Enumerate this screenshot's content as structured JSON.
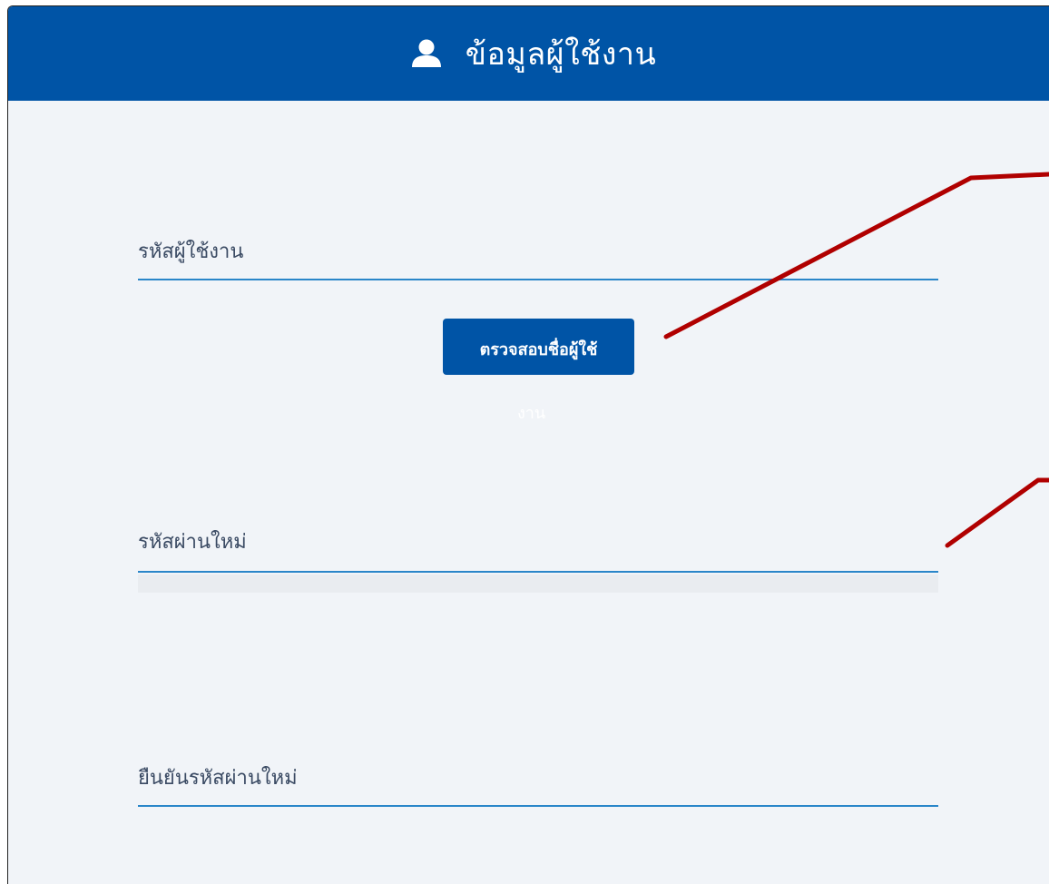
{
  "header": {
    "title": "ข้อมูลผู้ใช้งาน",
    "icon": "user-icon"
  },
  "form": {
    "username_label": "รหัสผู้ใช้งาน",
    "check_button_label": "ตรวจสอบชื่อผู้ใช้",
    "check_button_overflow": "งาน",
    "new_password_label": "รหัสผ่านใหม่",
    "confirm_password_label": "ยืนยันรหัสผ่านใหม่"
  },
  "colors": {
    "header_bg": "#0054a6",
    "page_bg": "#f1f4f8",
    "underline": "#2a86c9",
    "annotation": "#b00000"
  }
}
